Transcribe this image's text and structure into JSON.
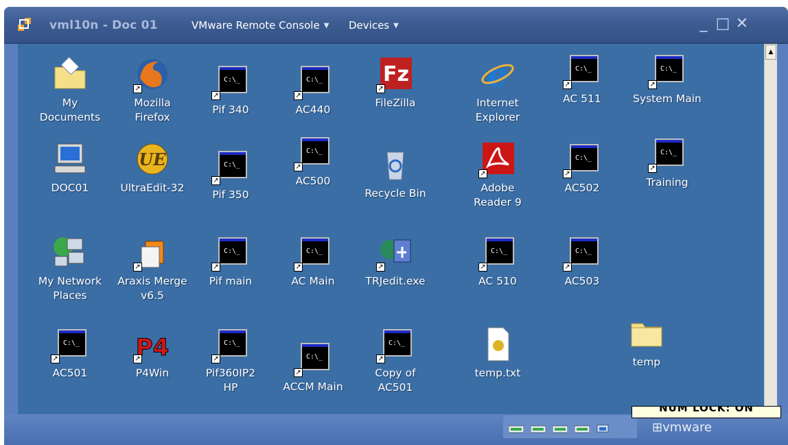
{
  "window": {
    "title": "vml10n - Doc 01",
    "menus": [
      {
        "label": "VMware Remote Console"
      },
      {
        "label": "Devices"
      }
    ],
    "controls": {
      "minimize": "_",
      "maximize": "□",
      "close": "✕"
    }
  },
  "desktop": {
    "icons": [
      {
        "label": "My\nDocuments",
        "icon": "folder-documents-icon",
        "shortcut": false
      },
      {
        "label": "Mozilla\nFirefox",
        "icon": "firefox-icon",
        "shortcut": true
      },
      {
        "label": "Pif 340",
        "icon": "msdos-icon",
        "shortcut": true
      },
      {
        "label": "AC440",
        "icon": "msdos-icon",
        "shortcut": true
      },
      {
        "label": "FileZilla",
        "icon": "filezilla-icon",
        "shortcut": true
      },
      {
        "label": "Internet\nExplorer",
        "icon": "internet-explorer-icon",
        "shortcut": false
      },
      {
        "label": "AC 511",
        "icon": "msdos-icon",
        "shortcut": true
      },
      {
        "label": "System Main",
        "icon": "msdos-icon",
        "shortcut": true
      },
      {
        "label": "DOC01",
        "icon": "computer-icon",
        "shortcut": false
      },
      {
        "label": "UltraEdit-32",
        "icon": "ultraedit-icon",
        "shortcut": false
      },
      {
        "label": "Pif 350",
        "icon": "msdos-icon",
        "shortcut": true
      },
      {
        "label": "AC500",
        "icon": "msdos-icon",
        "shortcut": true
      },
      {
        "label": "Recycle Bin",
        "icon": "recycle-bin-icon",
        "shortcut": false
      },
      {
        "label": "Adobe\nReader 9",
        "icon": "adobe-reader-icon",
        "shortcut": true
      },
      {
        "label": "AC502",
        "icon": "msdos-icon",
        "shortcut": true
      },
      {
        "label": "Training",
        "icon": "msdos-icon",
        "shortcut": true
      },
      {
        "label": "My Network\nPlaces",
        "icon": "network-places-icon",
        "shortcut": false
      },
      {
        "label": "Araxis Merge\nv6.5",
        "icon": "araxis-merge-icon",
        "shortcut": true
      },
      {
        "label": "Pif main",
        "icon": "msdos-icon",
        "shortcut": true
      },
      {
        "label": "AC Main",
        "icon": "msdos-icon",
        "shortcut": true
      },
      {
        "label": "TRJedit.exe",
        "icon": "trjedit-icon",
        "shortcut": true
      },
      {
        "label": "AC 510",
        "icon": "msdos-icon",
        "shortcut": true
      },
      {
        "label": "AC503",
        "icon": "msdos-icon",
        "shortcut": true
      },
      {
        "label": "AC501",
        "icon": "msdos-icon",
        "shortcut": true
      },
      {
        "label": "P4Win",
        "icon": "p4win-icon",
        "shortcut": true
      },
      {
        "label": "Pif360IP2\nHP",
        "icon": "msdos-icon",
        "shortcut": true
      },
      {
        "label": "ACCM Main",
        "icon": "msdos-icon",
        "shortcut": true
      },
      {
        "label": "Copy of\nAC501",
        "icon": "msdos-icon",
        "shortcut": true
      },
      {
        "label": "temp.txt",
        "icon": "text-file-icon",
        "shortcut": false
      },
      {
        "label": "temp",
        "icon": "folder-icon",
        "shortcut": false
      }
    ],
    "dos_prompt_text": "C:\\_"
  },
  "status": {
    "numlock_text": "NUM LOCK: ON",
    "vmware_logo": "vmware",
    "tray_devices": [
      "network-adapter-icon",
      "network-adapter-icon",
      "network-adapter-icon",
      "network-adapter-icon",
      "display-device-icon"
    ]
  },
  "colors": {
    "desktop_bg": "#3a6ea5",
    "titlebar_bg": "#3d5c92",
    "text_white": "#ffffff"
  }
}
